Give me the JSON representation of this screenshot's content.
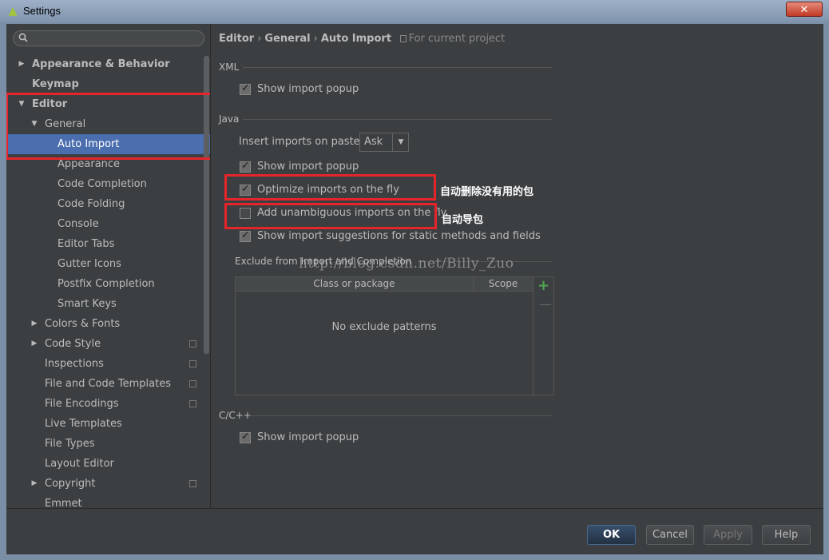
{
  "window": {
    "title": "Settings",
    "close_glyph": "✕"
  },
  "sidebar": {
    "search_placeholder": "",
    "items": [
      {
        "label": "Appearance & Behavior",
        "arrow": "▶"
      },
      {
        "label": "Keymap"
      },
      {
        "label": "Editor",
        "arrow": "▼"
      },
      {
        "label": "General",
        "arrow": "▼"
      },
      {
        "label": "Auto Import"
      },
      {
        "label": "Appearance"
      },
      {
        "label": "Code Completion"
      },
      {
        "label": "Code Folding"
      },
      {
        "label": "Console"
      },
      {
        "label": "Editor Tabs"
      },
      {
        "label": "Gutter Icons"
      },
      {
        "label": "Postfix Completion"
      },
      {
        "label": "Smart Keys"
      },
      {
        "label": "Colors & Fonts",
        "arrow": "▶"
      },
      {
        "label": "Code Style",
        "arrow": "▶"
      },
      {
        "label": "Inspections"
      },
      {
        "label": "File and Code Templates"
      },
      {
        "label": "File Encodings"
      },
      {
        "label": "Live Templates"
      },
      {
        "label": "File Types"
      },
      {
        "label": "Layout Editor"
      },
      {
        "label": "Copyright",
        "arrow": "▶"
      },
      {
        "label": "Emmet"
      }
    ]
  },
  "breadcrumb": {
    "items": [
      "Editor",
      "General",
      "Auto Import"
    ],
    "separator": "›",
    "note": "For current project"
  },
  "xml": {
    "title": "XML",
    "show_import_popup": "Show import popup"
  },
  "java": {
    "title": "Java",
    "insert_imports_label": "Insert imports on paste:",
    "insert_imports_value": "Ask",
    "show_import_popup": "Show import popup",
    "optimize_imports": "Optimize imports on the fly",
    "add_unambiguous": "Add unambiguous imports on the fly",
    "show_suggestions": "Show import suggestions for static methods and fields"
  },
  "annotations": {
    "optimize_note": "自动删除没有用的包",
    "add_note": "自动导包"
  },
  "exclude": {
    "title": "Exclude from Import and Completion",
    "columns": [
      "Class or package",
      "Scope"
    ],
    "empty_text": "No exclude patterns",
    "add_glyph": "+",
    "remove_glyph": "—"
  },
  "watermark": "http://blog.csdn.net/Billy_Zuo",
  "cpp": {
    "title": "C/C++",
    "show_import_popup": "Show import popup"
  },
  "buttons": {
    "ok": "OK",
    "cancel": "Cancel",
    "apply": "Apply",
    "help": "Help"
  },
  "colors": {
    "selection": "#4b6eaf",
    "highlight_box": "#e5252a",
    "background": "#3c3f41"
  }
}
